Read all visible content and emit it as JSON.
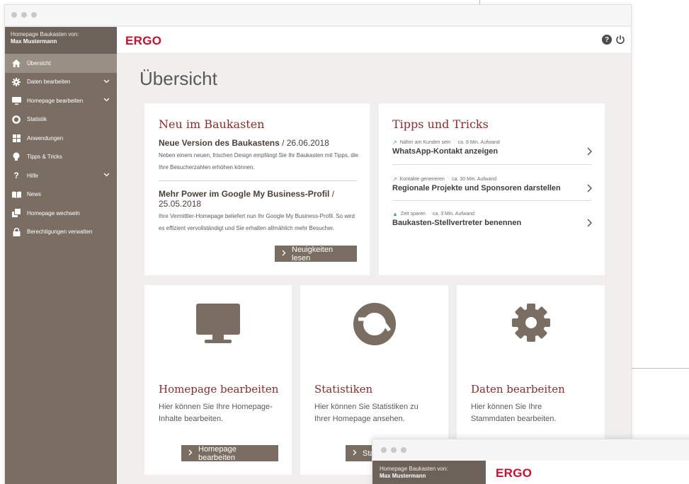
{
  "sidebar": {
    "owner_label": "Homepage Baukasten von:",
    "owner_name": "Max Mustermann",
    "items": [
      {
        "label": "Übersicht",
        "icon": "home-icon",
        "active": true,
        "has_chevron": false
      },
      {
        "label": "Daten bearbeiten",
        "icon": "gear-icon",
        "active": false,
        "has_chevron": true
      },
      {
        "label": "Homepage bearbeiten",
        "icon": "monitor-icon",
        "active": false,
        "has_chevron": true
      },
      {
        "label": "Statistik",
        "icon": "stats-icon",
        "active": false,
        "has_chevron": false
      },
      {
        "label": "Anwendungen",
        "icon": "grid-icon",
        "active": false,
        "has_chevron": false
      },
      {
        "label": "Tipps & Tricks",
        "icon": "lightbulb-icon",
        "active": false,
        "has_chevron": false
      },
      {
        "label": "Hilfe",
        "icon": "question-icon",
        "active": false,
        "has_chevron": true
      },
      {
        "label": "News",
        "icon": "book-icon",
        "active": false,
        "has_chevron": false
      },
      {
        "label": "Homepage wechseln",
        "icon": "pages-icon",
        "active": false,
        "has_chevron": false
      },
      {
        "label": "Berechtigungen verwalten",
        "icon": "lock-icon",
        "active": false,
        "has_chevron": false
      }
    ]
  },
  "header": {
    "logo": "ERGO",
    "help_label": "?"
  },
  "main": {
    "title": "Übersicht",
    "news": {
      "title": "Neu im Baukasten",
      "items": [
        {
          "headline": "Neue Version des Baukastens",
          "date": " / 26.06.2018",
          "text": "Neben einem neuen, frischen Design empfängt Sie Ihr Baukasten mit Tipps, die Ihre Besucherzahlen erhöhen können."
        },
        {
          "headline": "Mehr Power im Google My Business-Profil",
          "date": " / 25.05.2018",
          "text": "Ihre Vermittler-Homepage beliefert nun Ihr Google My Business-Profil. So wird es effizient vervollständigt und Sie erhalten allmählich mehr Besucher."
        }
      ],
      "button_label": "Neuigkeiten lesen"
    },
    "tips": {
      "title": "Tipps und Tricks",
      "items": [
        {
          "category": "Näher am Kunden sein",
          "effort": "ca. 8 Min. Aufwand",
          "title": "WhatsApp-Kontakt anzeigen"
        },
        {
          "category": "Kontakte generieren",
          "effort": "ca. 30 Min. Aufwand",
          "title": "Regionale Projekte und Sponsoren darstellen"
        },
        {
          "category": "Zeit sparen",
          "effort": "ca. 3 Min. Aufwand",
          "title": "Baukasten-Stellvertreter benennen"
        }
      ]
    },
    "features": [
      {
        "title": "Homepage bearbeiten",
        "text": "Hier können Sie Ihre Homepage-Inhalte bearbeiten.",
        "button_label": "Homepage bearbeiten",
        "icon": "monitor-icon"
      },
      {
        "title": "Statistiken",
        "text": "Hier können Sie Statistiken zu Ihrer Homepage ansehen.",
        "button_label": "Stat",
        "icon": "stats-icon"
      },
      {
        "title": "Daten bearbeiten",
        "text": "Hier können Sie Ihre Stammdaten bearbeiten.",
        "icon": "gear-icon"
      }
    ]
  },
  "second_window": {
    "owner_label": "Homepage Baukasten von:",
    "owner_name": "Max Mustermann",
    "logo": "ERGO"
  },
  "colors": {
    "sidebar": "#7a6e63",
    "sidebar_active": "#9a8f85",
    "accent_red": "#c8102e",
    "title_red": "#8e2b2b",
    "background": "#f0efee"
  }
}
